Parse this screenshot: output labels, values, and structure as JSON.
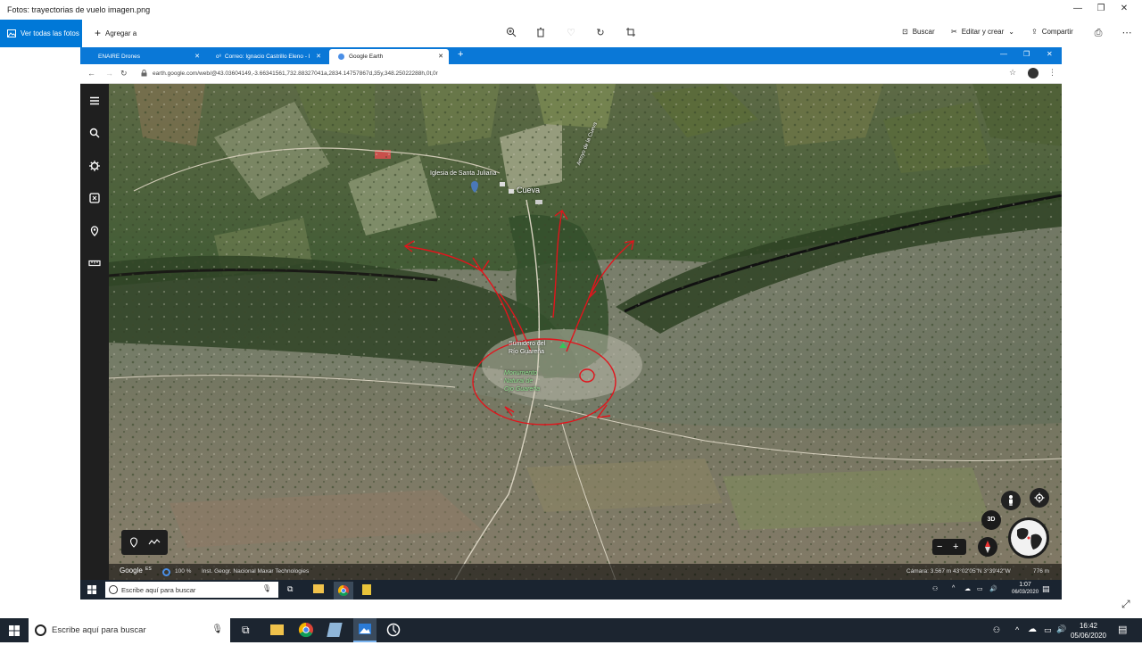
{
  "photos": {
    "title": "Fotos: trayectorias de vuelo imagen.png",
    "all_photos_label": "Ver todas las fotos",
    "add_label": "Agregar a",
    "search_label": "Buscar",
    "edit_label": "Editar y crear",
    "share_label": "Compartir"
  },
  "browser": {
    "tabs": [
      {
        "label": "ENAIRE Drones"
      },
      {
        "label": "Correo: Ignacio Castrillo Eleno - I"
      },
      {
        "label": "Google Earth"
      }
    ],
    "url": "earth.google.com/web/@43.03604149,-3.66341561,732.88327041a,2834.14757867d,35y,348.25022288h,0t,0r"
  },
  "map": {
    "labels": {
      "church": "Iglesia de Santa Juliana",
      "town": "Cueva",
      "stream": "Arroyo de la Cueva",
      "sink_1": "Sumidero del",
      "sink_2": "Río Guareña",
      "monument_1": "Monumento",
      "monument_2": "Natural de",
      "monument_3": "Ojo Guareña"
    },
    "status": {
      "logo": "Google",
      "es": "ES",
      "zoom": "100 %",
      "credits": "Inst. Geogr. Nacional  Maxar Technologies",
      "camera": "Cámara: 3.567 m   43°02'05\"N 3°39'42\"W",
      "scale": "776 m"
    },
    "btn_3d": "3D"
  },
  "inner_taskbar": {
    "search_placeholder": "Escribe aquí para buscar",
    "time": "1:07",
    "date": "06/03/2020"
  },
  "taskbar": {
    "search_placeholder": "Escribe aquí para buscar",
    "time": "16:42",
    "date": "05/06/2020"
  },
  "colors": {
    "accent": "#0078d7",
    "route": "#e2141c"
  }
}
